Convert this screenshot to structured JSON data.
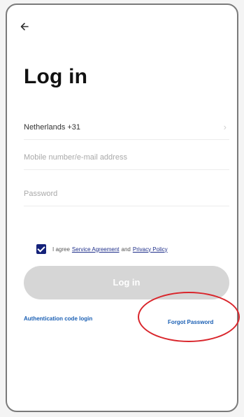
{
  "screen": {
    "back_icon": "arrow-left-icon",
    "title": "Log in"
  },
  "form": {
    "country_value": "Netherlands +31",
    "country_chevron_icon": "chevron-right-icon",
    "account_placeholder": "Mobile number/e-mail address",
    "password_placeholder": "Password"
  },
  "agreement": {
    "checked": true,
    "prefix": "I agree",
    "service_link": "Service Agreement",
    "and_text": "and",
    "privacy_link": "Privacy Policy"
  },
  "login_button_label": "Log in",
  "auth_code_link": "Authentication code login",
  "forgot_password_link": "Forgot Password",
  "colors": {
    "accent": "#1a5fb4",
    "checkbox": "#14227a",
    "button_disabled": "#d6d6d6",
    "highlight": "#d9252b"
  }
}
